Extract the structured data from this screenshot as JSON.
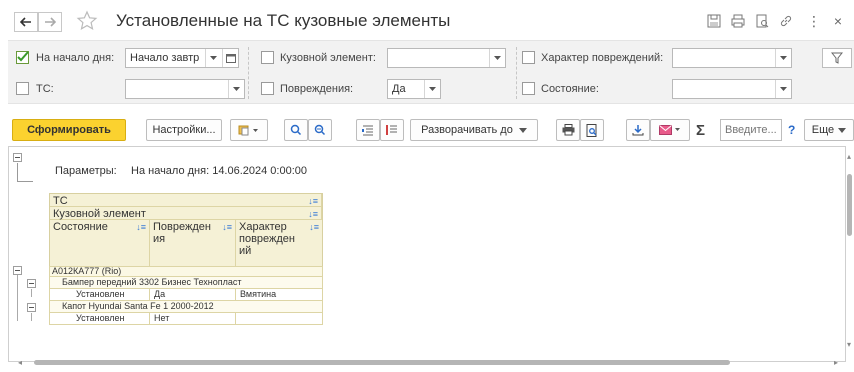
{
  "window": {
    "title": "Установленные на ТС кузовные элементы",
    "menu_label": "⋮",
    "close_label": "×"
  },
  "filters": {
    "start_of_day": {
      "label": "На начало дня:",
      "checked": true,
      "value": "Начало завтр"
    },
    "body_element": {
      "label": "Кузовной элемент:",
      "checked": false,
      "value": ""
    },
    "damage_type": {
      "label": "Характер повреждений:",
      "checked": false,
      "value": ""
    },
    "vehicle": {
      "label": "ТС:",
      "checked": false,
      "value": ""
    },
    "damages": {
      "label": "Повреждения:",
      "checked": false,
      "value": "Да"
    },
    "state": {
      "label": "Состояние:",
      "checked": false,
      "value": ""
    }
  },
  "toolbar": {
    "generate_label": "Сформировать",
    "settings_label": "Настройки...",
    "expand_label": "Разворачивать до",
    "sum_label": "Σ",
    "search_placeholder": "Введите...",
    "help_label": "?",
    "more_label": "Еще"
  },
  "report": {
    "params_label": "Параметры:",
    "params_value": "На начало дня: 14.06.2024 0:00:00",
    "header": {
      "col_vehicle": "ТС",
      "col_element": "Кузовной элемент",
      "col_state": "Состояние",
      "col_damage_l1": "Поврежден",
      "col_damage_l2": "ия",
      "col_kind_l1": "Характер",
      "col_kind_l2": "поврежден",
      "col_kind_l3": "ий"
    },
    "rows": [
      {
        "vehicle": "А012КА777 (Rio)"
      },
      {
        "element": "Бампер передний 3302 Бизнес Технопласт",
        "state": "Установлен",
        "damage": "Да",
        "kind": "Вмятина"
      },
      {
        "element": "Капот Hyundai Santa Fe 1 2000-2012",
        "state": "Установлен",
        "damage": "Нет",
        "kind": ""
      }
    ]
  },
  "colors": {
    "primary_button": "#fbd22f",
    "checkbox_check": "#4caf50",
    "header_bg": "#f5f1d6",
    "accent_blue": "#3a7bd5"
  }
}
